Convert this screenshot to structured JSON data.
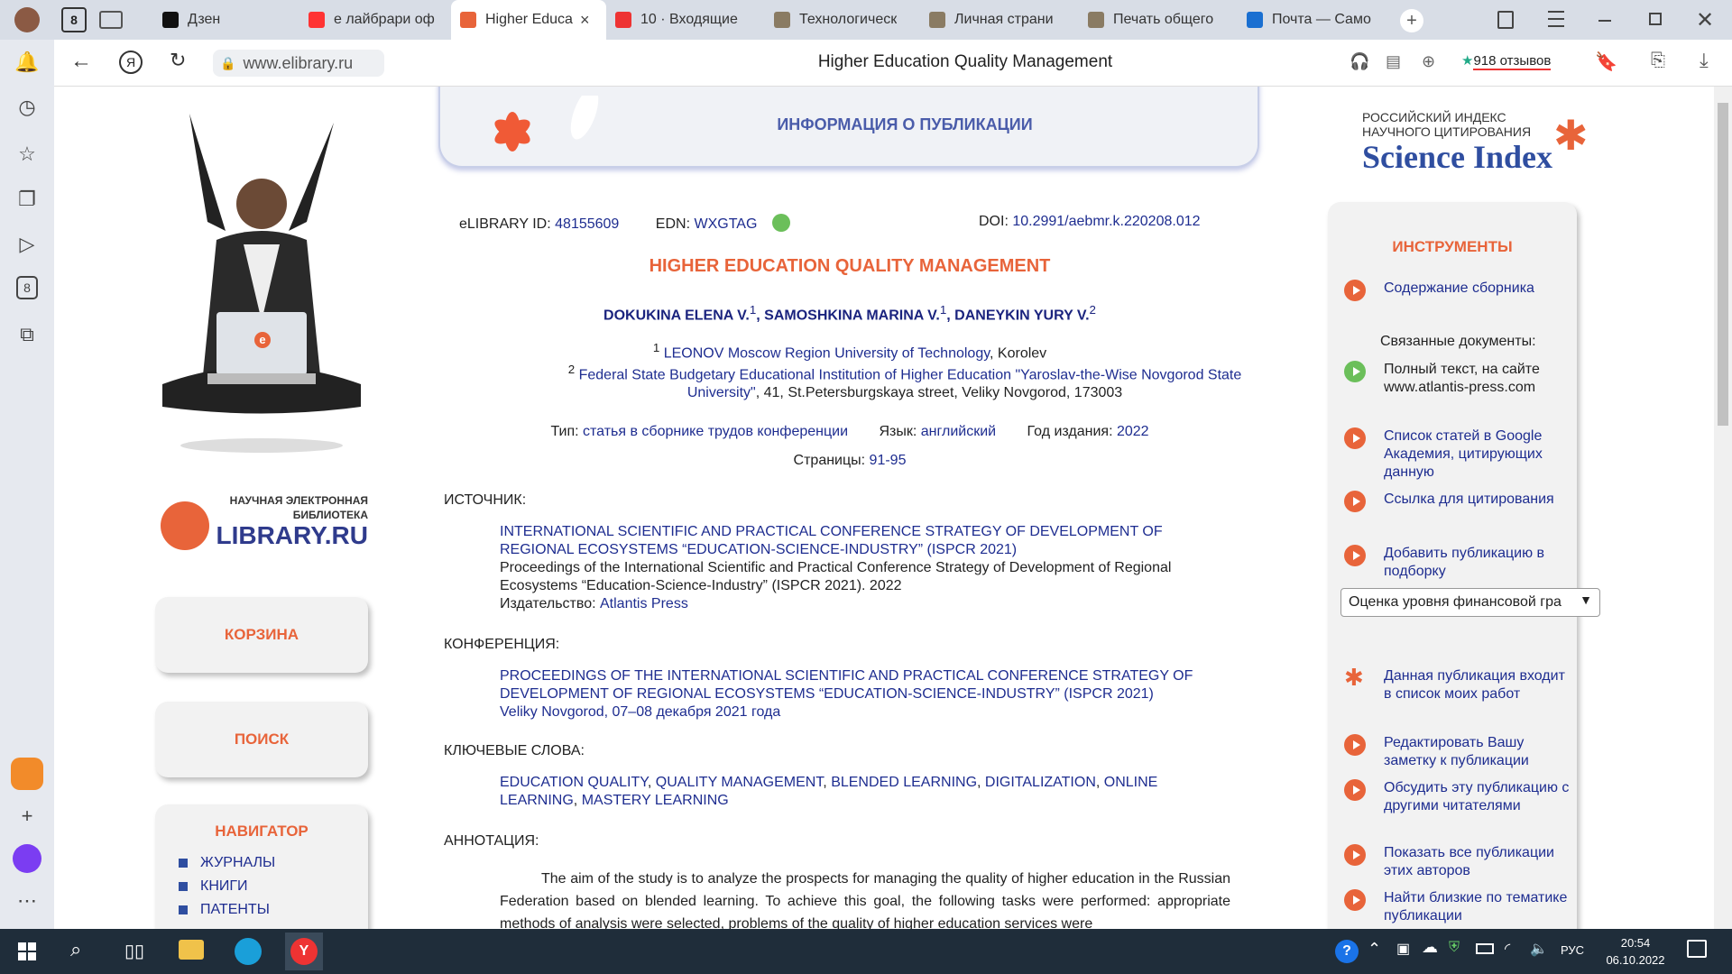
{
  "browser": {
    "tabs": [
      {
        "label": "Дзен",
        "icon": "dzen-icon",
        "color": "#111"
      },
      {
        "label": "е лайбрари оф",
        "icon": "yandex-icon",
        "color": "#f33"
      },
      {
        "label": "Higher Educa",
        "icon": "elibrary-icon",
        "color": "#e8643a",
        "active": true
      },
      {
        "label": "10 · Входящие",
        "icon": "mail-icon",
        "color": "#e33"
      },
      {
        "label": "Технологическ",
        "icon": "site-icon",
        "color": "#8a7b63"
      },
      {
        "label": "Личная страни",
        "icon": "site-icon",
        "color": "#8a7b63"
      },
      {
        "label": "Печать общего",
        "icon": "site-icon",
        "color": "#8a7b63"
      },
      {
        "label": "Почта — Само",
        "icon": "outlook-icon",
        "color": "#1a6fd1"
      }
    ],
    "tab_counter": "8",
    "close_glyph": "×",
    "url": "www.elibrary.ru",
    "page_title": "Higher Education Quality Management",
    "reviews": "918 отзывов",
    "left_badge": "8"
  },
  "site": {
    "header_banner": "ИНФОРМАЦИЯ О ПУБЛИКАЦИИ",
    "logo_top": "НАУЧНАЯ ЭЛЕКТРОННАЯ",
    "logo_mid": "БИБЛИОТЕКА",
    "logo_main": "LIBRARY.RU",
    "laptop_logo": "e",
    "rinc_line1": "РОССИЙСКИЙ ИНДЕКС",
    "rinc_line2": "НАУЧНОГО ЦИТИРОВАНИЯ",
    "rinc_main": "Science Index",
    "nav_cart": "КОРЗИНА",
    "nav_search": "ПОИСК",
    "nav_navigator": "НАВИГАТОР",
    "nav_items": [
      "ЖУРНАЛЫ",
      "КНИГИ",
      "ПАТЕНТЫ"
    ]
  },
  "pub": {
    "id_label": "eLIBRARY ID:",
    "id": "48155609",
    "edn_label": "EDN:",
    "edn": "WXGTAG",
    "doi_label": "DOI:",
    "doi": "10.2991/aebmr.k.220208.012",
    "title": "HIGHER EDUCATION QUALITY MANAGEMENT",
    "authors": [
      {
        "name": "DOKUKINA ELENA V.",
        "sup": "1"
      },
      {
        "name": "SAMOSHKINA MARINA V.",
        "sup": "1"
      },
      {
        "name": "DANEYKIN YURY V.",
        "sup": "2"
      }
    ],
    "author_sep": ",",
    "aff1_sup": "1",
    "aff1_link": "LEONOV Moscow Region University of Technology",
    "aff1_rest": ", Korolev",
    "aff2_sup": "2",
    "aff2_link": "Federal State Budgetary Educational Institution of Higher Education \"Yaroslav-the-Wise Novgorod State University\"",
    "aff2_rest": ", 41, St.Petersburgskaya street, Veliky Novgorod, 173003",
    "type_label": "Тип:",
    "type": "статья в сборнике трудов конференции",
    "lang_label": "Язык:",
    "lang": "английский",
    "year_label": "Год издания:",
    "year": "2022",
    "pages_label": "Страницы:",
    "pages": "91-95",
    "source_label": "ИСТОЧНИК:",
    "source_link": "INTERNATIONAL SCIENTIFIC AND PRACTICAL CONFERENCE STRATEGY OF DEVELOPMENT OF REGIONAL ECOSYSTEMS “EDUCATION-SCIENCE-INDUSTRY” (ISPCR 2021)",
    "source_text": "Proceedings of the International Scientific and Practical Conference Strategy of Development of Regional Ecosystems “Education-Science-Industry” (ISPCR 2021). 2022",
    "publisher_label": "Издательство:",
    "publisher": "Atlantis Press",
    "conf_label": "КОНФЕРЕНЦИЯ:",
    "conf_link": "PROCEEDINGS OF THE INTERNATIONAL SCIENTIFIC AND PRACTICAL CONFERENCE STRATEGY OF DEVELOPMENT OF REGIONAL ECOSYSTEMS “EDUCATION-SCIENCE-INDUSTRY” (ISPCR 2021)",
    "conf_place": "Veliky Novgorod, 07–08 декабря 2021 года",
    "kw_label": "КЛЮЧЕВЫЕ СЛОВА:",
    "keywords": [
      "EDUCATION QUALITY",
      "QUALITY MANAGEMENT",
      "BLENDED LEARNING",
      "DIGITALIZATION",
      "ONLINE LEARNING",
      "MASTERY LEARNING"
    ],
    "abs_label": "АННОТАЦИЯ:",
    "abstract": "The aim of the study is to analyze the prospects for managing the quality of higher education in the Russian Federation based on blended learning. To achieve this goal, the following tasks were performed: appropriate methods of analysis were selected, problems of the quality of higher education services were"
  },
  "tools": {
    "heading": "ИНСТРУМЕНТЫ",
    "contents": "Содержание сборника",
    "related": "Связанные документы:",
    "fulltext": "Полный текст, на сайте www.atlantis-press.com",
    "scholar": "Список статей в Google Академия, цитирующих данную",
    "cite": "Ссылка для цитирования",
    "add": "Добавить публикацию в подборку",
    "select_value": "Оценка уровня финансовой гра",
    "mywork": "Данная публикация входит в список моих работ",
    "note": "Редактировать Вашу заметку к публикации",
    "discuss": "Обсудить эту публикацию с другими читателями",
    "allpubs": "Показать все публикации этих авторов",
    "similar": "Найти близкие по тематике публикации"
  },
  "taskbar": {
    "lang": "РУС",
    "time": "20:54",
    "date": "06.10.2022"
  }
}
